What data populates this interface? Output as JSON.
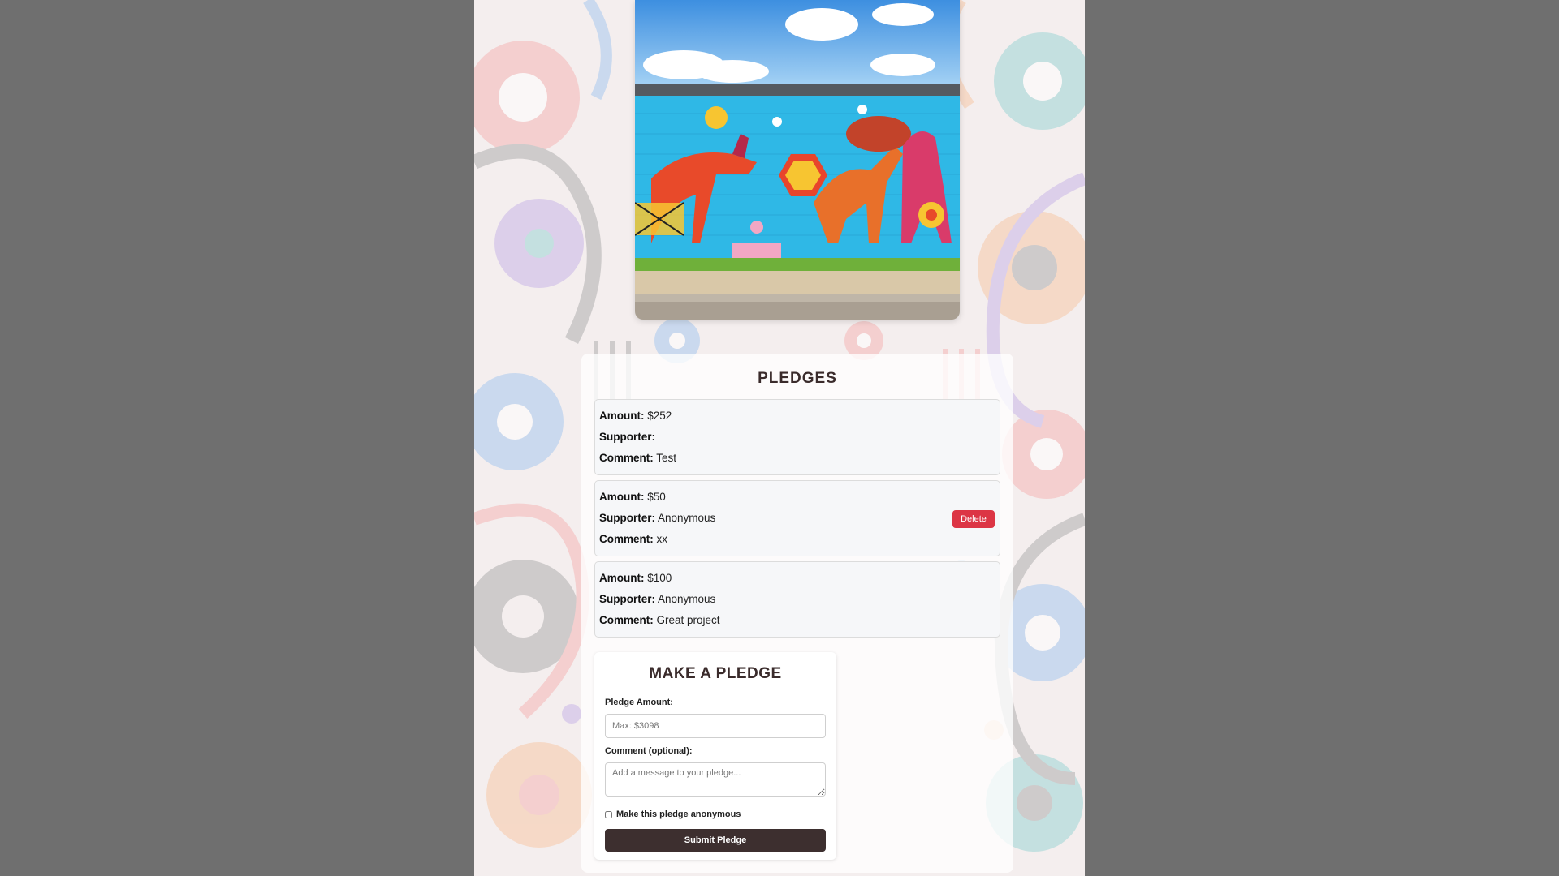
{
  "pledges_section": {
    "title": "PLEDGES",
    "pledges": [
      {
        "amount_label": "Amount:",
        "amount": "$252",
        "supporter_label": "Supporter:",
        "supporter": "",
        "comment_label": "Comment:",
        "comment": "Test"
      },
      {
        "amount_label": "Amount:",
        "amount": "$50",
        "supporter_label": "Supporter:",
        "supporter": "Anonymous",
        "comment_label": "Comment:",
        "comment": "xx",
        "delete_label": "Delete"
      },
      {
        "amount_label": "Amount:",
        "amount": "$100",
        "supporter_label": "Supporter:",
        "supporter": "Anonymous",
        "comment_label": "Comment:",
        "comment": "Great project"
      }
    ]
  },
  "form": {
    "title": "MAKE A PLEDGE",
    "amount_label": "Pledge Amount:",
    "amount_placeholder": "Max: $3098",
    "amount_value": "",
    "comment_label": "Comment (optional):",
    "comment_placeholder": "Add a message to your pledge...",
    "comment_value": "",
    "anonymous_label": "Make this pledge anonymous",
    "anonymous_checked": false,
    "submit_label": "Submit Pledge"
  },
  "colors": {
    "page_bg": "#6f6f6f",
    "delete": "#dc3545",
    "submit": "#3d2f2f",
    "title": "#3a2b2b"
  },
  "icons": {
    "hero": "mural-image"
  }
}
